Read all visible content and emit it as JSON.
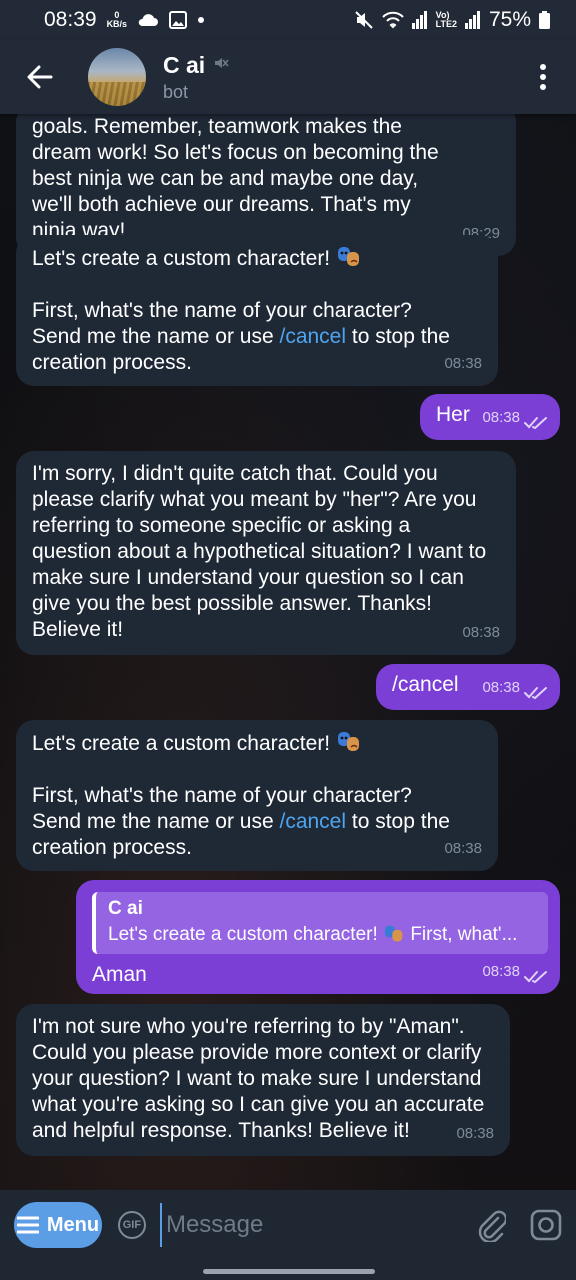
{
  "status_bar": {
    "time": "08:39",
    "net_speed_value": "0",
    "net_speed_unit": "KB/s",
    "volte_label": "Vo)\nLTE2",
    "battery": "75%"
  },
  "header": {
    "title": "C ai",
    "subtitle": "bot"
  },
  "messages": [
    {
      "direction": "in",
      "text": "goals. Remember, teamwork makes the dream work! So let's focus on becoming the best ninja we can be and maybe one day, we'll both achieve our dreams. That's my ninja way!",
      "time": "08:29"
    },
    {
      "direction": "in",
      "line1": "Let's create a custom character!",
      "line2": "First, what's the name of your character?",
      "line3_prefix": "Send me the name or use ",
      "command": "/cancel",
      "line3_suffix": " to stop the",
      "line4": "creation process.",
      "time": "08:38"
    },
    {
      "direction": "out",
      "text": "Her",
      "time": "08:38"
    },
    {
      "direction": "in",
      "text": "I'm sorry, I didn't quite catch that. Could you please clarify what you meant by \"her\"? Are you referring to someone specific or asking a question about a hypothetical situation? I want to make sure I understand your question so I can give you the best possible answer. Thanks! Believe it!",
      "time": "08:38"
    },
    {
      "direction": "out",
      "text": "/cancel",
      "time": "08:38"
    },
    {
      "direction": "in",
      "line1": "Let's create a custom character!",
      "line2": "First, what's the name of your character?",
      "line3_prefix": "Send me the name or use ",
      "command": "/cancel",
      "line3_suffix": " to stop the",
      "line4": "creation process.",
      "time": "08:38"
    },
    {
      "direction": "out",
      "reply_name": "C ai",
      "reply_text_prefix": "Let's create a custom character!",
      "reply_text_suffix": "First, what'...",
      "text": "Aman",
      "time": "08:38"
    },
    {
      "direction": "in",
      "text": "I'm not sure who you're referring to by \"Aman\". Could you please provide more context or clarify your question? I want to make sure I understand what you're asking so I can give you an accurate and helpful response. Thanks! Believe it!",
      "time": "08:38"
    }
  ],
  "input_bar": {
    "menu_label": "Menu",
    "gif_label": "GIF",
    "placeholder": "Message"
  },
  "icons": {
    "back": "arrow-left-icon",
    "muted": "muted-speaker-icon",
    "more": "vertical-dots-icon",
    "attach": "paperclip-icon",
    "camera": "camera-icon",
    "read": "double-check-icon",
    "emoji": "performing-arts-masks"
  },
  "colors": {
    "header_bg": "#212a36",
    "incoming_bubble": "#1f2936",
    "outgoing_bubble": "#7b3fd6",
    "link": "#4ea4ee",
    "menu_button": "#5b9ee6"
  }
}
